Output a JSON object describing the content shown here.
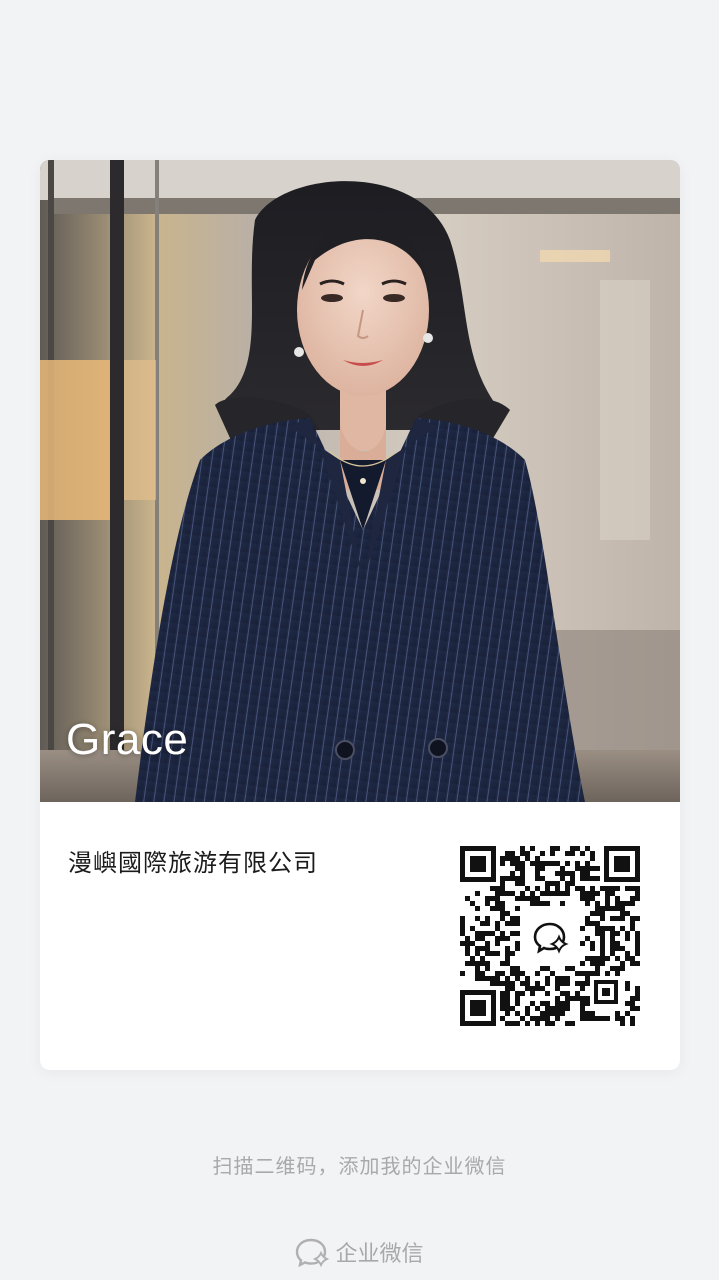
{
  "card": {
    "name": "Grace",
    "company": "漫嶼國際旅游有限公司"
  },
  "hint": "扫描二维码，添加我的企业微信",
  "brand": {
    "label": "企业微信",
    "icon": "wecom-icon"
  },
  "qr": {
    "icon": "wecom-logo-icon"
  },
  "colors": {
    "page_bg": "#f2f3f5",
    "card_bg": "#ffffff",
    "muted_text": "#a9a9a9",
    "suit_navy": "#1c2742"
  }
}
